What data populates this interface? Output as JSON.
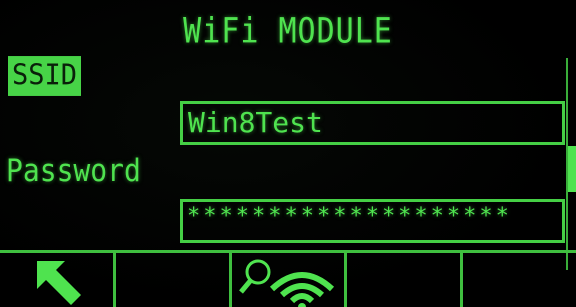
{
  "title": "WiFi MODULE",
  "ssid": {
    "label": "SSID",
    "value": "Win8Test"
  },
  "password": {
    "label": "Password",
    "value": "********************"
  },
  "softkeys": [
    {
      "icon": "back-arrow-icon"
    },
    {
      "icon": ""
    },
    {
      "icon": "wifi-search-icon"
    },
    {
      "icon": ""
    },
    {
      "icon": ""
    }
  ],
  "colors": {
    "foreground": "#4fe34f",
    "background": "#000000",
    "highlight": "#47d447"
  }
}
